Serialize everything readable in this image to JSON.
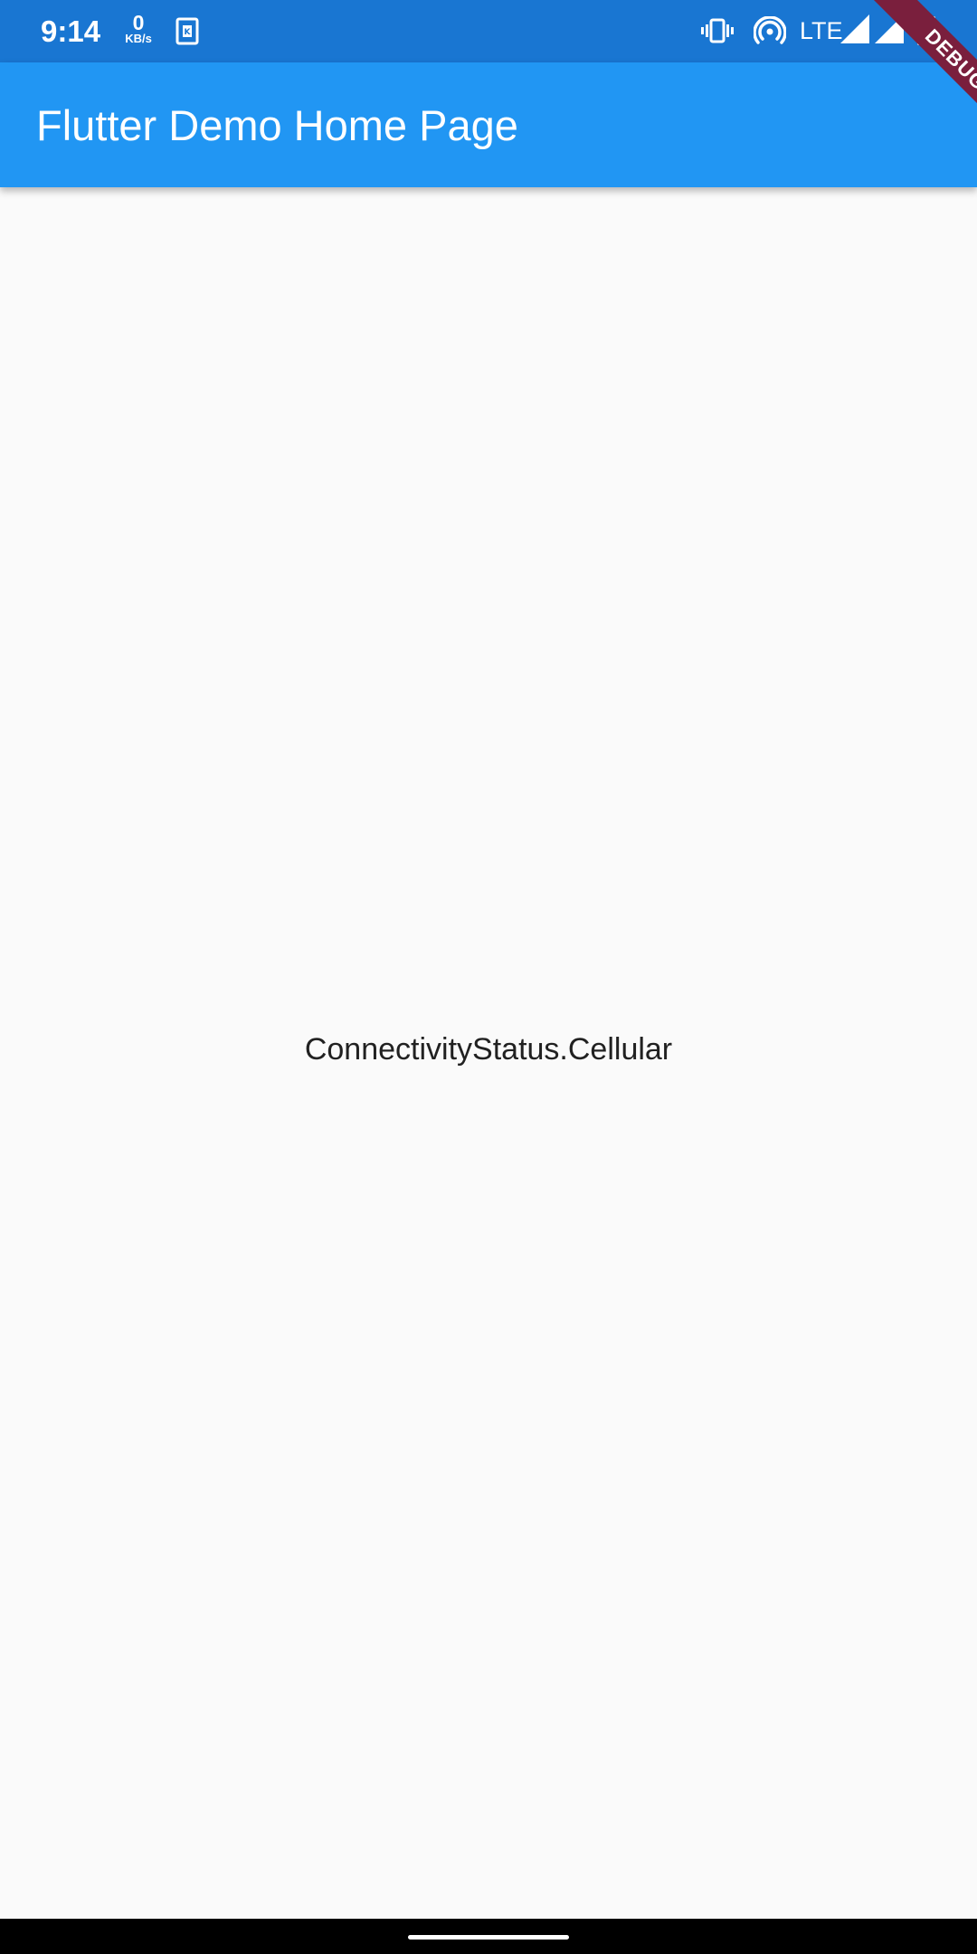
{
  "status_bar": {
    "time": "9:14",
    "net_speed_value": "0",
    "net_speed_unit": "KB/s",
    "network_label": "LTE",
    "icons": [
      "sim-card-icon",
      "vibrate-icon",
      "hotspot-icon",
      "signal-icon",
      "signal-icon",
      "battery-icon"
    ]
  },
  "app_bar": {
    "title": "Flutter Demo Home Page",
    "color": "#2196F3"
  },
  "main": {
    "connectivity_text": "ConnectivityStatus.Cellular"
  },
  "debug_banner": {
    "label": "DEBUG"
  }
}
